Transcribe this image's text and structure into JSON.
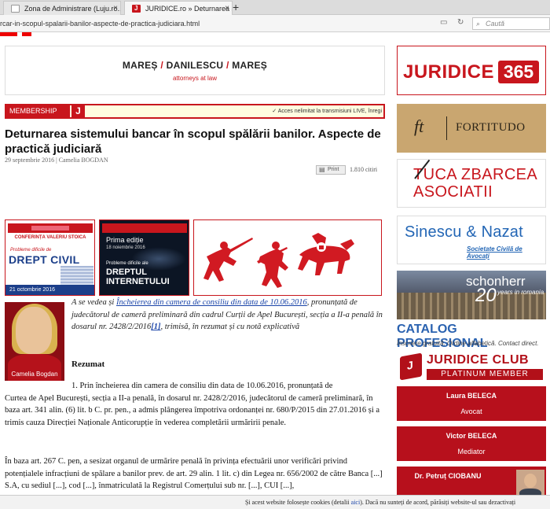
{
  "browser": {
    "tabs": [
      {
        "label": "Zona de Administrare (Luju.ro..."
      },
      {
        "label": "JURIDICE.ro » Deturnarea s..."
      }
    ],
    "new_tab_label": "+",
    "close_label": "×",
    "url": "rcar-in-scopul-spalarii-banilor-aspecte-de-practica-judiciara.html",
    "search_placeholder": "Caută"
  },
  "banner": {
    "firm_part1": "MAREȘ",
    "firm_part2": "DANILESCU",
    "firm_part3": "MAREȘ",
    "separator": "/",
    "subtitle": "attorneys at law"
  },
  "membership": {
    "label": "MEMBERSHIP",
    "j": "J",
    "text": "✓ Acces nelimitat la transmisiuni LIVE, înregi"
  },
  "article": {
    "title": "Deturnarea sistemului bancar în scopul spălării banilor. Aspecte de practică judiciară",
    "date": "29 septembrie 2016",
    "separator": "|",
    "author": "Camelia BOGDAN",
    "print_label": "Print",
    "reads": "1.810 citiri",
    "author_caption": "Camelia Bogdan",
    "intro_a": "A se vedea și ",
    "intro_link": "Încheierea din camera de consiliu din data de 10.06.2016",
    "intro_b": ", pronunțată de judecătorul de cameră preliminară din cadrul Curții de Apel București, secția a II-a penală în dosarul nr. 2428/2/2016",
    "intro_fn": "[1]",
    "intro_c": ", trimisă, în rezumat și cu notă explicativă",
    "rezumat": "Rezumat",
    "p1_first": "1. Prin încheierea din camera de consiliu din data de 10.06.2016, pronunțată de",
    "p1_rest": "Curtea de Apel București, secția a II-a penală, în dosarul nr. 2428/2/2016, judecătorul de cameră preliminară, în baza art. 341 alin. (6) lit. b C. pr. pen., a admis plângerea împotriva ordonanței nr. 680/P/2015 din 27.01.2016 și a trimis cauza Direcției Naționale Anticorupție în vederea completării urmăririi penale.",
    "p2": "În baza art. 267 C. pen, a sesizat organul de urmărire penală în privința efectuării unor verificări privind potențialele infracțiuni de spălare a banilor prev. de art. 29 alin. 1 lit. c) din Legea nr. 656/2002 de către Banca [...]  S.A, cu sediul [...], cod [...], înmatriculată la Registrul Comerțului sub nr. [...], CUI [...],"
  },
  "ads": {
    "ad1": {
      "conf": "CONFERINȚA VALERIU STOICA",
      "probl": "Probleme dificile de",
      "big": "DREPT CIVIL",
      "date": "21 octombrie 2016"
    },
    "ad2": {
      "edition": "Prima ediție",
      "date": "18 noiembrie 2016",
      "probl": "Probleme dificile ale",
      "big1": "DREPTUL",
      "big2": "INTERNETULUI"
    }
  },
  "sidebar": {
    "j365_text": "JURIDICE",
    "j365_num": "365",
    "fortitudo_mark": "ft",
    "fortitudo_name": "FORTITUDO",
    "tuca_l1": "TUCA ZBARCEA",
    "tuca_l2": "ASOCIATII",
    "sinescu_name": "Sinescu & Nazat",
    "sinescu_sub": "Societate Civilă de Avocați",
    "schonherr_name": "schonherr",
    "schonherr_20": "20",
    "schonherr_years": "years in romania",
    "catalog_title": "CATALOG PROFESIONAL",
    "catalog_sub": "Înscriere gratuită. Ordine alfabetică. Contact direct.",
    "club_title": "JURIDICE CLUB",
    "club_sub": "PLATINUM MEMBER",
    "people": [
      {
        "name": "Laura BELECA",
        "role": "Avocat"
      },
      {
        "name": "Victor BELECA",
        "role": "Mediator"
      },
      {
        "name": "Dr. Petruț CIOBANU",
        "role": "Avocat"
      }
    ]
  },
  "cookie": {
    "text_a": "Și acest website folosește cookies (detalii ",
    "link": "aici",
    "text_b": "). Dacă nu sunteți de acord, părăsiți website-ul sau dezactivați"
  },
  "colors": {
    "brand_red": "#c8161d",
    "link_blue": "#1a44a8"
  }
}
